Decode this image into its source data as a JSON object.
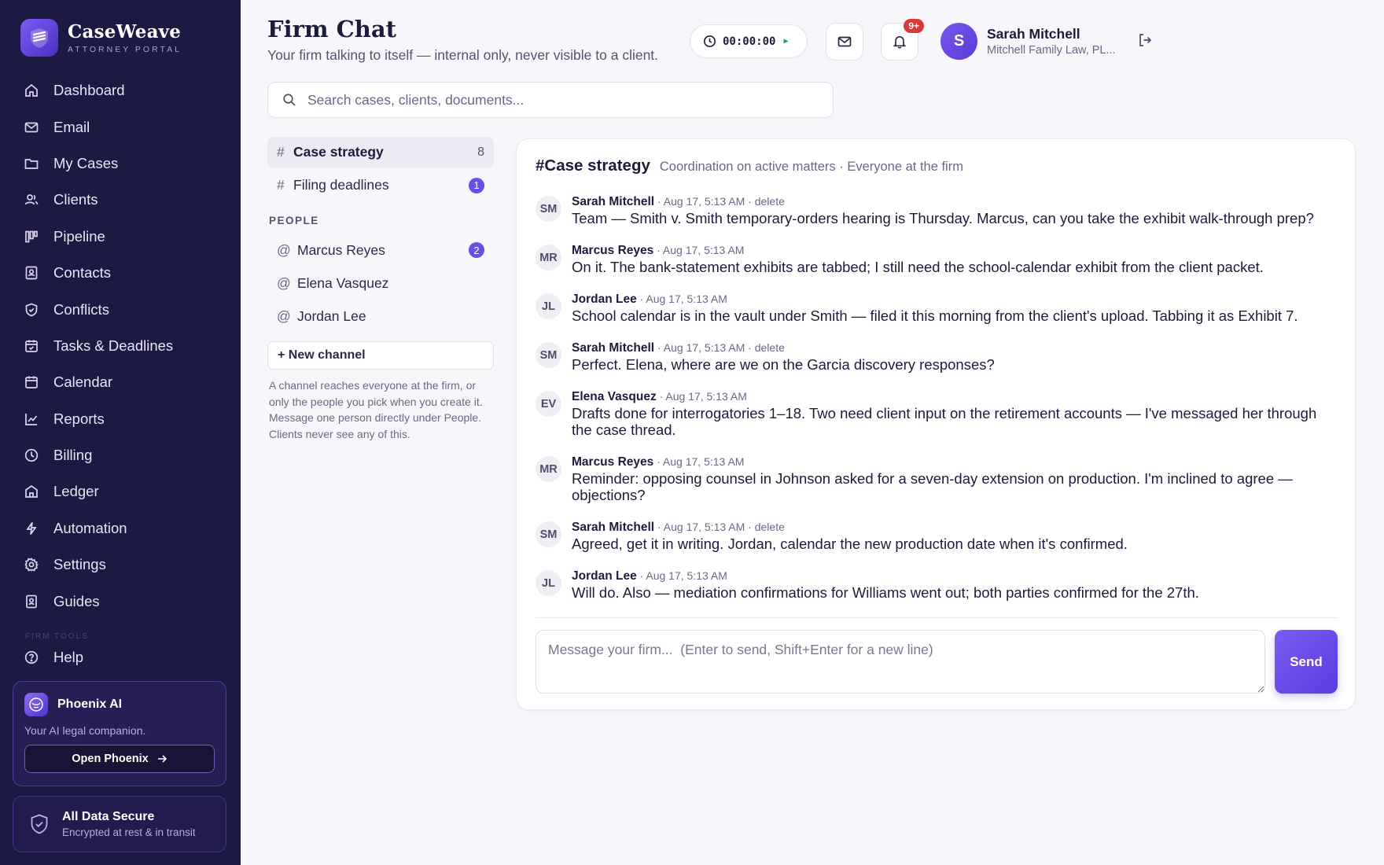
{
  "brand": {
    "name": "CaseWeave",
    "sub": "ATTORNEY PORTAL"
  },
  "nav": [
    {
      "label": "Dashboard",
      "icon": "home-icon"
    },
    {
      "label": "Email",
      "icon": "mail-icon"
    },
    {
      "label": "My Cases",
      "icon": "folder-icon"
    },
    {
      "label": "Clients",
      "icon": "users-icon"
    },
    {
      "label": "Pipeline",
      "icon": "kanban-icon"
    },
    {
      "label": "Contacts",
      "icon": "contact-card-icon"
    },
    {
      "label": "Conflicts",
      "icon": "shield-check-icon"
    },
    {
      "label": "Tasks & Deadlines",
      "icon": "calendar-check-icon"
    },
    {
      "label": "Calendar",
      "icon": "calendar-icon"
    },
    {
      "label": "Reports",
      "icon": "line-chart-icon"
    },
    {
      "label": "Billing",
      "icon": "clock-icon"
    },
    {
      "label": "Ledger",
      "icon": "bank-icon"
    },
    {
      "label": "Automation",
      "icon": "lightning-icon"
    },
    {
      "label": "Settings",
      "icon": "gear-icon"
    },
    {
      "label": "Guides",
      "icon": "book-icon"
    }
  ],
  "nav_section_fade": "FIRM TOOLS",
  "help_label": "Help",
  "phoenix": {
    "title": "Phoenix AI",
    "subtitle": "Your AI legal companion.",
    "button": "Open Phoenix"
  },
  "secure": {
    "title": "All Data Secure",
    "subtitle": "Encrypted at rest & in transit"
  },
  "header": {
    "title": "Firm Chat",
    "subtitle": "Your firm talking to itself — internal only, never visible to a client.",
    "timer": "00:00:00",
    "notifications_badge": "9+",
    "user_name": "Sarah Mitchell",
    "user_firm": "Mitchell Family Law, PL...",
    "user_initial": "S"
  },
  "search": {
    "placeholder": "Search cases, clients, documents..."
  },
  "channels": [
    {
      "prefix": "#",
      "label": "Case strategy",
      "count": "8",
      "active": true
    },
    {
      "prefix": "#",
      "label": "Filing deadlines",
      "unread": "1"
    }
  ],
  "people_heading": "PEOPLE",
  "people": [
    {
      "prefix": "@",
      "label": "Marcus Reyes",
      "unread": "2"
    },
    {
      "prefix": "@",
      "label": "Elena Vasquez"
    },
    {
      "prefix": "@",
      "label": "Jordan Lee"
    }
  ],
  "new_channel_label": "+ New channel",
  "channel_help": "A channel reaches everyone at the firm, or only the people you pick when you create it. Message one person directly under People. Clients never see any of this.",
  "chat": {
    "title": "#Case strategy",
    "description": "Coordination on active matters · Everyone at the firm",
    "messages": [
      {
        "initials": "SM",
        "author": "Sarah Mitchell",
        "time": "· Aug 17, 5:13 AM",
        "delete": "· delete",
        "text": "Team — Smith v. Smith temporary-orders hearing is Thursday. Marcus, can you take the exhibit walk-through prep?"
      },
      {
        "initials": "MR",
        "author": "Marcus Reyes",
        "time": "· Aug 17, 5:13 AM",
        "delete": "",
        "text": "On it. The bank-statement exhibits are tabbed; I still need the school-calendar exhibit from the client packet."
      },
      {
        "initials": "JL",
        "author": "Jordan Lee",
        "time": "· Aug 17, 5:13 AM",
        "delete": "",
        "text": "School calendar is in the vault under Smith — filed it this morning from the client's upload. Tabbing it as Exhibit 7."
      },
      {
        "initials": "SM",
        "author": "Sarah Mitchell",
        "time": "· Aug 17, 5:13 AM",
        "delete": "· delete",
        "text": "Perfect. Elena, where are we on the Garcia discovery responses?"
      },
      {
        "initials": "EV",
        "author": "Elena Vasquez",
        "time": "· Aug 17, 5:13 AM",
        "delete": "",
        "text": "Drafts done for interrogatories 1–18. Two need client input on the retirement accounts — I've messaged her through the case thread."
      },
      {
        "initials": "MR",
        "author": "Marcus Reyes",
        "time": "· Aug 17, 5:13 AM",
        "delete": "",
        "text": "Reminder: opposing counsel in Johnson asked for a seven-day extension on production. I'm inclined to agree — objections?"
      },
      {
        "initials": "SM",
        "author": "Sarah Mitchell",
        "time": "· Aug 17, 5:13 AM",
        "delete": "· delete",
        "text": "Agreed, get it in writing. Jordan, calendar the new production date when it's confirmed."
      },
      {
        "initials": "JL",
        "author": "Jordan Lee",
        "time": "· Aug 17, 5:13 AM",
        "delete": "",
        "text": "Will do. Also — mediation confirmations for Williams went out; both parties confirmed for the 27th."
      }
    ],
    "compose_placeholder": "Message your firm...  (Enter to send, Shift+Enter for a new line)",
    "send_label": "Send"
  },
  "colors": {
    "sidebar": "#1c1942",
    "accent": "#6b4ee6",
    "badge": "#d93a3a",
    "background": "#f7f6fb"
  }
}
